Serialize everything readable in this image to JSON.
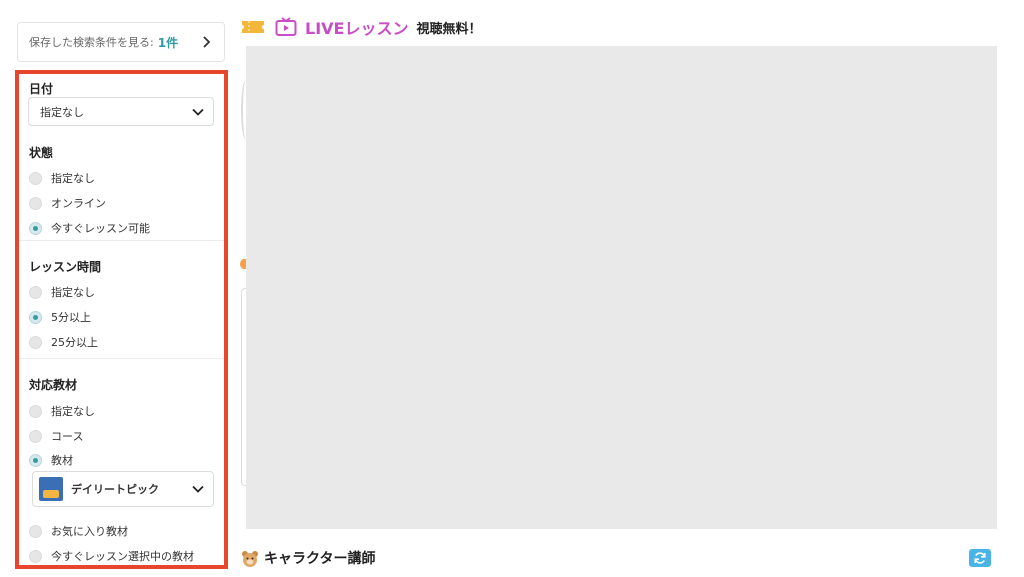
{
  "saved_search": {
    "label": "保存した検索条件を見る:",
    "count": "1件"
  },
  "filters": {
    "date": {
      "title": "日付",
      "selected": "指定なし"
    },
    "status": {
      "title": "状態",
      "options": [
        {
          "label": "指定なし",
          "checked": false
        },
        {
          "label": "オンライン",
          "checked": false
        },
        {
          "label": "今すぐレッスン可能",
          "checked": true
        }
      ]
    },
    "lesson_time": {
      "title": "レッスン時間",
      "options": [
        {
          "label": "指定なし",
          "checked": false
        },
        {
          "label": "5分以上",
          "checked": true
        },
        {
          "label": "25分以上",
          "checked": false
        }
      ]
    },
    "material": {
      "title": "対応教材",
      "options": [
        {
          "label": "指定なし",
          "checked": false
        },
        {
          "label": "コース",
          "checked": false
        },
        {
          "label": "教材",
          "checked": true
        }
      ],
      "selected_material": "デイリートピック",
      "extra_options": [
        {
          "label": "お気に入り教材",
          "checked": false
        },
        {
          "label": "今すぐレッスン選択中の教材",
          "checked": false
        }
      ]
    }
  },
  "live": {
    "title": "LIVEレッスン",
    "subtitle": "視聴無料！"
  },
  "character_section": {
    "title": "キャラクター講師"
  },
  "colors": {
    "highlight_border": "#e8452f",
    "accent_teal": "#3a9aa5",
    "live_purple": "#c94dc6",
    "refresh_blue": "#4ab4e6"
  },
  "icons": [
    "chevron-right-icon",
    "chevron-down-icon",
    "ticket-icon",
    "tv-play-icon",
    "bear-icon",
    "refresh-icon"
  ]
}
